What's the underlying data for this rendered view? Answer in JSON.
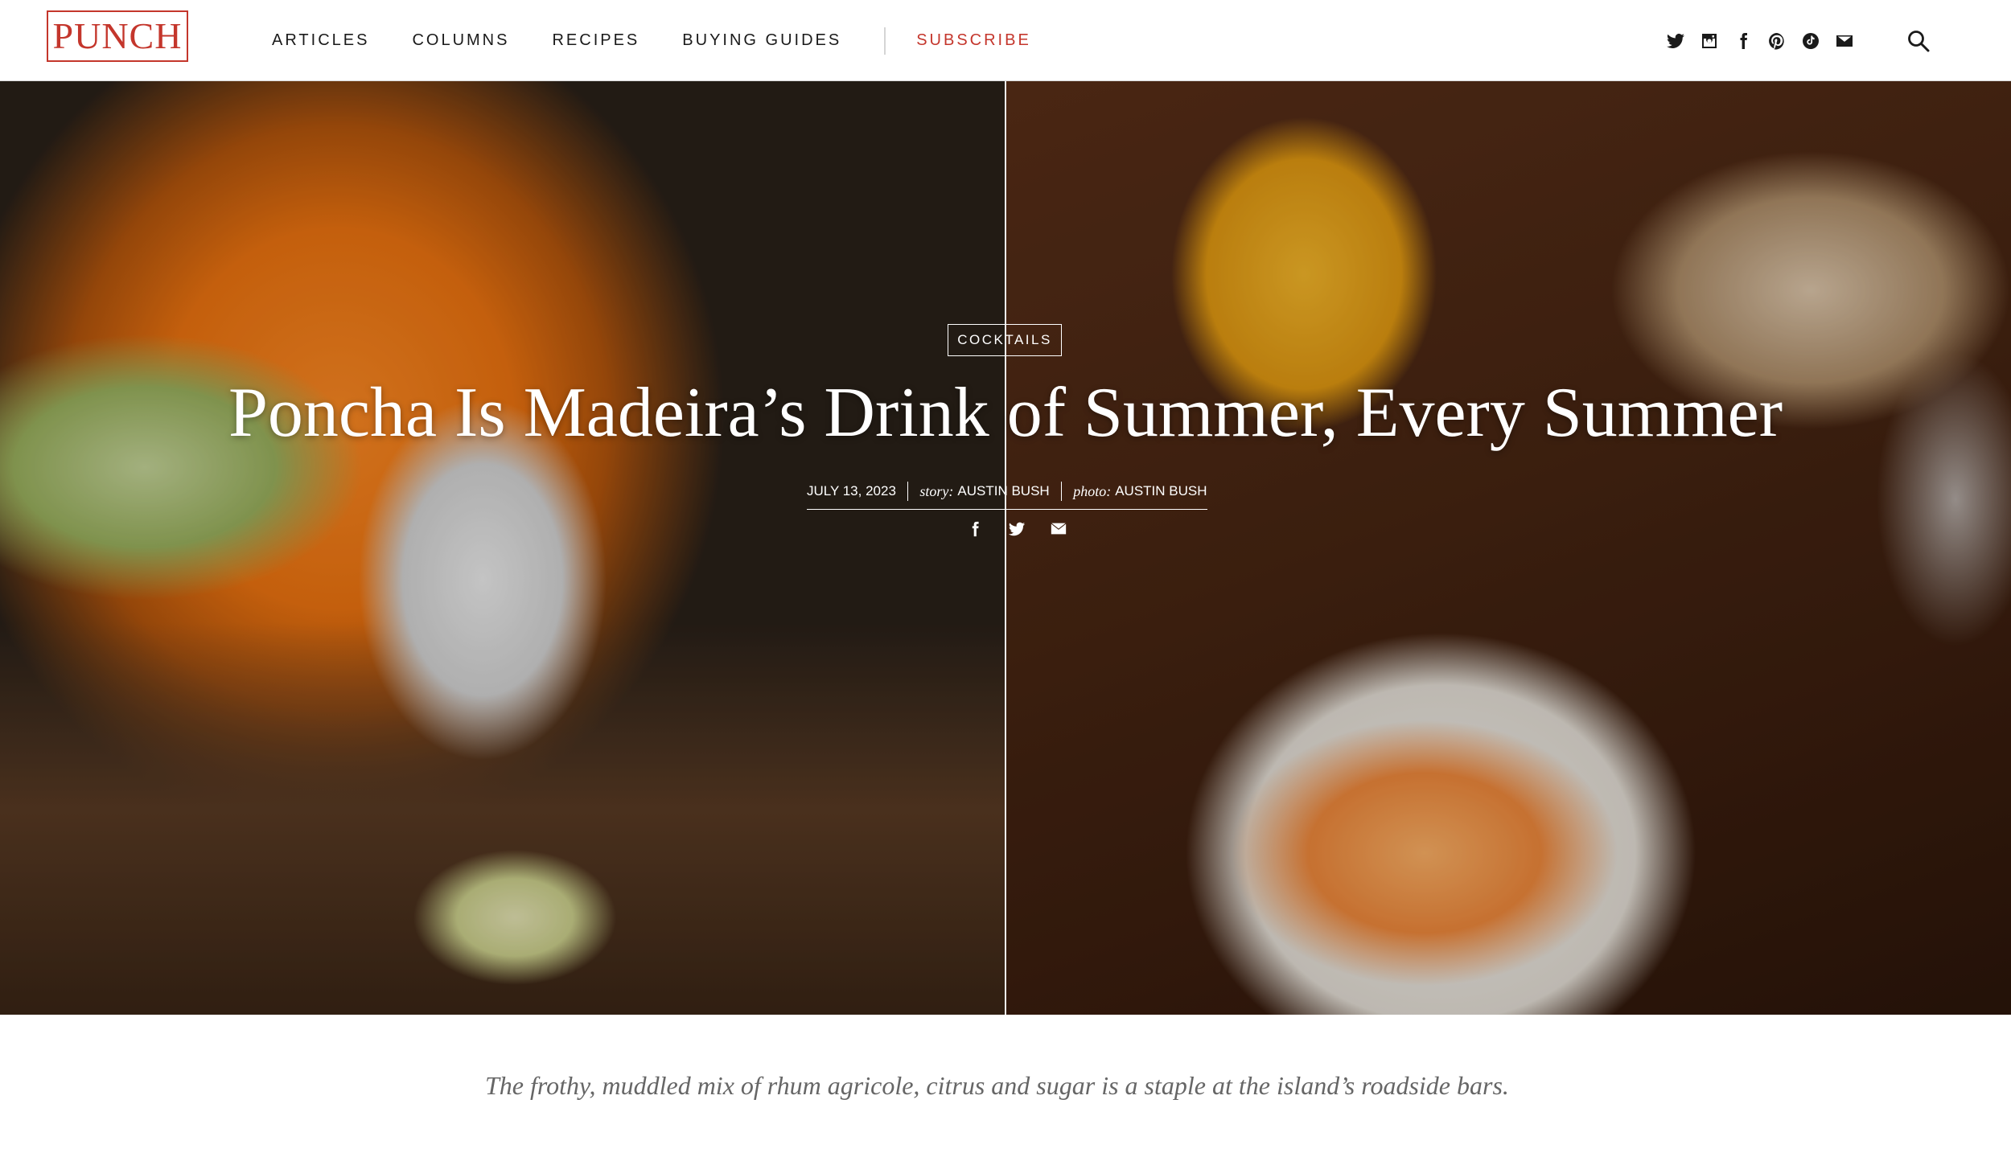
{
  "site": {
    "logo": "PUNCH"
  },
  "nav": {
    "items": [
      {
        "label": "ARTICLES"
      },
      {
        "label": "COLUMNS"
      },
      {
        "label": "RECIPES"
      },
      {
        "label": "BUYING GUIDES"
      }
    ],
    "subscribe": "SUBSCRIBE"
  },
  "social_icons": [
    "twitter-icon",
    "instagram-icon",
    "facebook-icon",
    "pinterest-icon",
    "tiktok-icon",
    "mail-icon"
  ],
  "colors": {
    "brand": "#c4362c",
    "text": "#1a1a1a",
    "dek": "#666666"
  },
  "article": {
    "category": "COCKTAILS",
    "title": "Poncha Is Madeira’s Drink of Summer, Every Summer",
    "date": "JULY 13, 2023",
    "story_label": "story:",
    "story_author": "AUSTIN BUSH",
    "photo_label": "photo:",
    "photo_author": "AUSTIN BUSH",
    "share_icons": [
      "facebook-icon",
      "twitter-icon",
      "mail-icon"
    ],
    "dek": "The frothy, muddled mix of rhum agricole, citrus and sugar is a staple at the island’s roadside bars."
  }
}
